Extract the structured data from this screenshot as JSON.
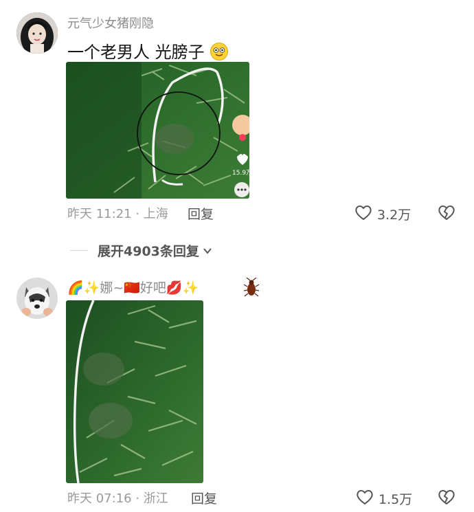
{
  "comments": [
    {
      "username": "元气少女猪刚隐",
      "text": "一个老男人 光膀子",
      "time_location": "昨天 11:21 · 上海",
      "reply_label": "回复",
      "like_count": "3.2万"
    },
    {
      "username": "🌈✨娜~🇨🇳好吧💋✨",
      "time_location": "昨天 07:16 · 浙江",
      "reply_label": "回复",
      "like_count": "1.5万"
    }
  ],
  "embedded_video": {
    "like_count": "15.9万"
  },
  "expand": {
    "label": "展开4903条回复"
  },
  "colors": {
    "text": "#161616",
    "muted": "#9a9a9a",
    "action": "#555555",
    "foliage": "#2f6a2a"
  }
}
